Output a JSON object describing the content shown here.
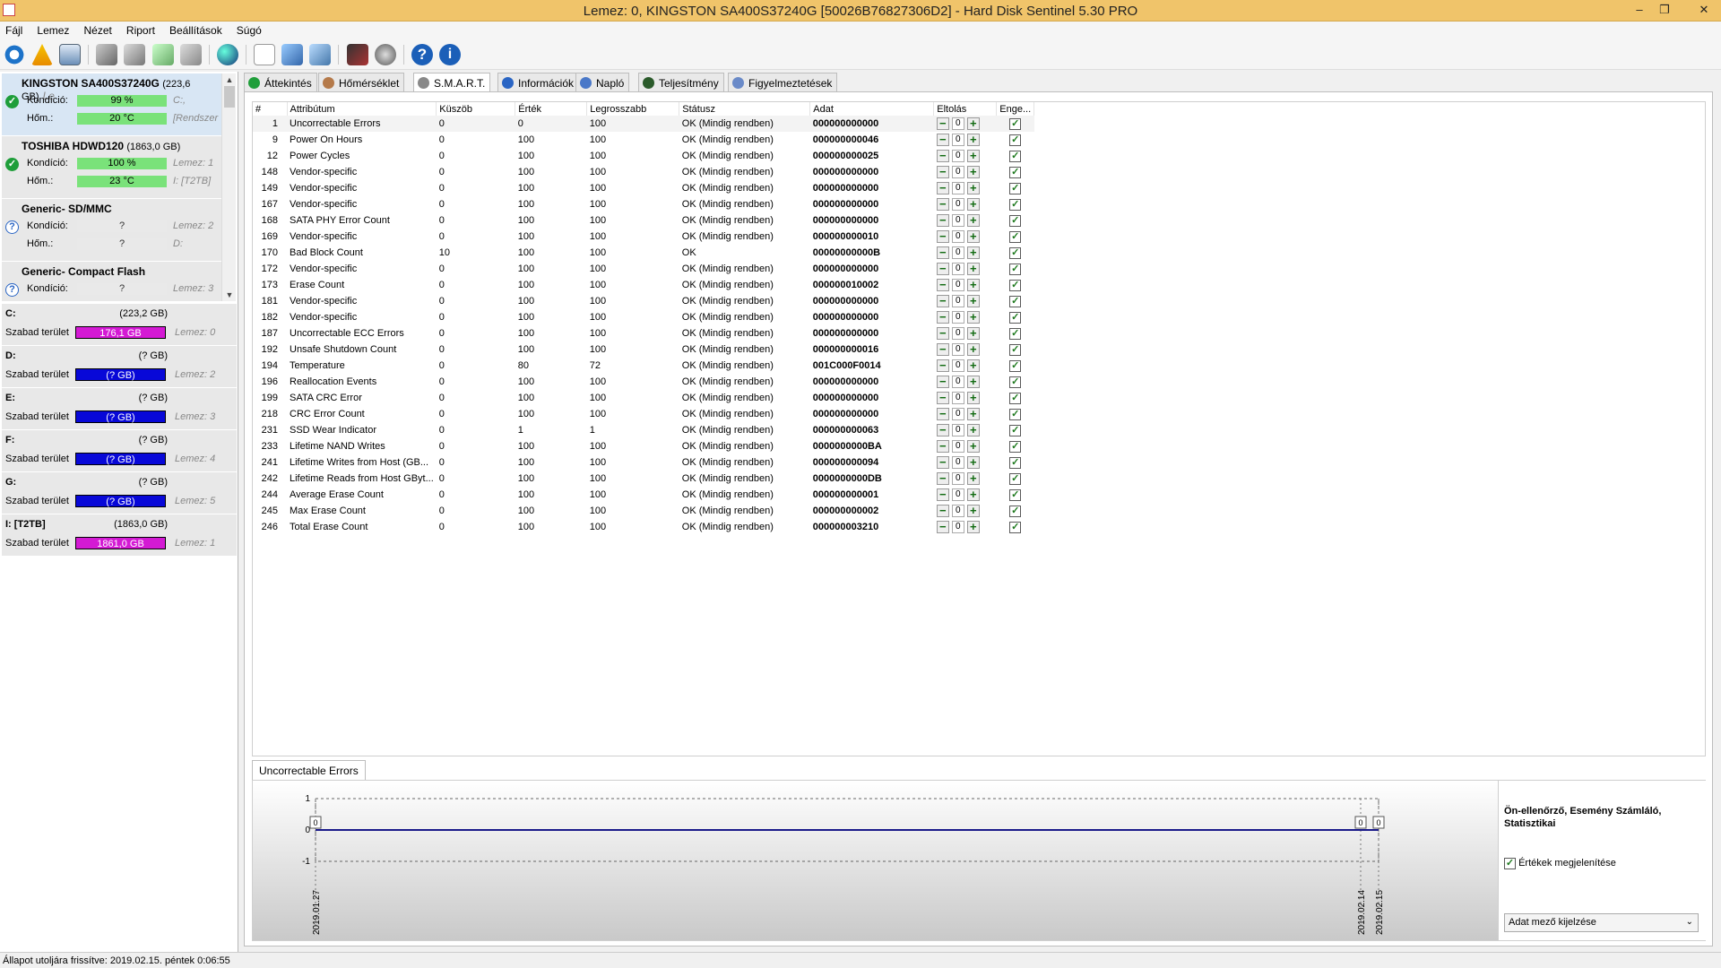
{
  "window": {
    "title": "Lemez: 0, KINGSTON SA400S37240G [50026B76827306D2]  -  Hard Disk Sentinel 5.30 PRO",
    "minimize": "–",
    "restore": "❐",
    "close": "✕"
  },
  "menu": [
    "Fájl",
    "Lemez",
    "Nézet",
    "Riport",
    "Beállítások",
    "Súgó"
  ],
  "disks": [
    {
      "name": "KINGSTON SA400S37240G",
      "size": "(223,6 GB)",
      "side_name": "Le",
      "status": "ok",
      "cond_label": "Kondíció:",
      "cond": "99 %",
      "cond_side": "C:,",
      "temp_label": "Hőm.:",
      "temp": "20 °C",
      "temp_side": "[Rendszer"
    },
    {
      "name": "TOSHIBA HDWD120",
      "size": "(1863,0 GB)",
      "side_name": "",
      "status": "ok",
      "cond_label": "Kondíció:",
      "cond": "100 %",
      "cond_side": "Lemez: 1",
      "temp_label": "Hőm.:",
      "temp": "23 °C",
      "temp_side": "I: [T2TB]"
    },
    {
      "name": "Generic- SD/MMC",
      "size": "",
      "side_name": "",
      "status": "q",
      "cond_label": "Kondíció:",
      "cond": "?",
      "cond_side": "Lemez: 2",
      "temp_label": "Hőm.:",
      "temp": "?",
      "temp_side": "D:"
    },
    {
      "name": "Generic- Compact Flash",
      "size": "",
      "side_name": "",
      "status": "q",
      "cond_label": "Kondíció:",
      "cond": "?",
      "cond_side": "Lemez: 3",
      "temp_label": "",
      "temp": "",
      "temp_side": ""
    }
  ],
  "volumes": [
    {
      "name": "C:",
      "size": "(223,2 GB)",
      "label": "Szabad terület",
      "free": "176,1 GB",
      "color": "mag",
      "disk": "Lemez: 0"
    },
    {
      "name": "D:",
      "size": "(? GB)",
      "label": "Szabad terület",
      "free": "(? GB)",
      "color": "blue",
      "disk": "Lemez: 2"
    },
    {
      "name": "E:",
      "size": "(? GB)",
      "label": "Szabad terület",
      "free": "(? GB)",
      "color": "blue",
      "disk": "Lemez: 3"
    },
    {
      "name": "F:",
      "size": "(? GB)",
      "label": "Szabad terület",
      "free": "(? GB)",
      "color": "blue",
      "disk": "Lemez: 4"
    },
    {
      "name": "G:",
      "size": "(? GB)",
      "label": "Szabad terület",
      "free": "(? GB)",
      "color": "blue",
      "disk": "Lemez: 5"
    },
    {
      "name": "I: [T2TB]",
      "size": "(1863,0 GB)",
      "label": "Szabad terület",
      "free": "1861,0 GB",
      "color": "mag",
      "disk": "Lemez: 1"
    }
  ],
  "tabs": [
    {
      "label": "Áttekintés",
      "icon": "check-icon",
      "color": "#1f9e3a"
    },
    {
      "label": "Hőmérséklet",
      "icon": "thermometer-icon",
      "color": "#b57a4a"
    },
    {
      "label": "S.M.A.R.T.",
      "icon": "disk-icon",
      "color": "#888"
    },
    {
      "label": "Információk",
      "icon": "info-icon",
      "color": "#2a65c4"
    },
    {
      "label": "Napló",
      "icon": "log-icon",
      "color": "#4a78c8"
    },
    {
      "label": "Teljesítmény",
      "icon": "speed-icon",
      "color": "#2a5a2a"
    },
    {
      "label": "Figyelmeztetések",
      "icon": "alert-icon",
      "color": "#6a8ac8"
    }
  ],
  "smart": {
    "headers": [
      "#",
      "Attribútum",
      "Küszöb",
      "Érték",
      "Legrosszabb",
      "Státusz",
      "Adat",
      "Eltolás",
      "Enge..."
    ],
    "rows": [
      [
        "1",
        "Uncorrectable Errors",
        "0",
        "0",
        "100",
        "OK (Mindig rendben)",
        "000000000000"
      ],
      [
        "9",
        "Power On Hours",
        "0",
        "100",
        "100",
        "OK (Mindig rendben)",
        "000000000046"
      ],
      [
        "12",
        "Power Cycles",
        "0",
        "100",
        "100",
        "OK (Mindig rendben)",
        "000000000025"
      ],
      [
        "148",
        "Vendor-specific",
        "0",
        "100",
        "100",
        "OK (Mindig rendben)",
        "000000000000"
      ],
      [
        "149",
        "Vendor-specific",
        "0",
        "100",
        "100",
        "OK (Mindig rendben)",
        "000000000000"
      ],
      [
        "167",
        "Vendor-specific",
        "0",
        "100",
        "100",
        "OK (Mindig rendben)",
        "000000000000"
      ],
      [
        "168",
        "SATA PHY Error Count",
        "0",
        "100",
        "100",
        "OK (Mindig rendben)",
        "000000000000"
      ],
      [
        "169",
        "Vendor-specific",
        "0",
        "100",
        "100",
        "OK (Mindig rendben)",
        "000000000010"
      ],
      [
        "170",
        "Bad Block Count",
        "10",
        "100",
        "100",
        "OK",
        "00000000000B"
      ],
      [
        "172",
        "Vendor-specific",
        "0",
        "100",
        "100",
        "OK (Mindig rendben)",
        "000000000000"
      ],
      [
        "173",
        "Erase Count",
        "0",
        "100",
        "100",
        "OK (Mindig rendben)",
        "000000010002"
      ],
      [
        "181",
        "Vendor-specific",
        "0",
        "100",
        "100",
        "OK (Mindig rendben)",
        "000000000000"
      ],
      [
        "182",
        "Vendor-specific",
        "0",
        "100",
        "100",
        "OK (Mindig rendben)",
        "000000000000"
      ],
      [
        "187",
        "Uncorrectable ECC Errors",
        "0",
        "100",
        "100",
        "OK (Mindig rendben)",
        "000000000000"
      ],
      [
        "192",
        "Unsafe Shutdown Count",
        "0",
        "100",
        "100",
        "OK (Mindig rendben)",
        "000000000016"
      ],
      [
        "194",
        "Temperature",
        "0",
        "80",
        "72",
        "OK (Mindig rendben)",
        "001C000F0014"
      ],
      [
        "196",
        "Reallocation Events",
        "0",
        "100",
        "100",
        "OK (Mindig rendben)",
        "000000000000"
      ],
      [
        "199",
        "SATA CRC Error",
        "0",
        "100",
        "100",
        "OK (Mindig rendben)",
        "000000000000"
      ],
      [
        "218",
        "CRC Error Count",
        "0",
        "100",
        "100",
        "OK (Mindig rendben)",
        "000000000000"
      ],
      [
        "231",
        "SSD Wear Indicator",
        "0",
        "1",
        "1",
        "OK (Mindig rendben)",
        "000000000063"
      ],
      [
        "233",
        "Lifetime NAND Writes",
        "0",
        "100",
        "100",
        "OK (Mindig rendben)",
        "0000000000BA"
      ],
      [
        "241",
        "Lifetime Writes from Host (GB...",
        "0",
        "100",
        "100",
        "OK (Mindig rendben)",
        "000000000094"
      ],
      [
        "242",
        "Lifetime Reads from Host GByt...",
        "0",
        "100",
        "100",
        "OK (Mindig rendben)",
        "0000000000DB"
      ],
      [
        "244",
        "Average Erase Count",
        "0",
        "100",
        "100",
        "OK (Mindig rendben)",
        "000000000001"
      ],
      [
        "245",
        "Max Erase Count",
        "0",
        "100",
        "100",
        "OK (Mindig rendben)",
        "000000000002"
      ],
      [
        "246",
        "Total Erase Count",
        "0",
        "100",
        "100",
        "OK (Mindig rendben)",
        "000000003210"
      ]
    ],
    "offset_value": "0",
    "minus": "−",
    "plus": "+",
    "check": "✓"
  },
  "bottom_tab": "Uncorrectable Errors",
  "chart_data": {
    "type": "line",
    "title": "",
    "x": [
      "2019.01.27",
      "2019.02.14",
      "2019.02.15"
    ],
    "series": [
      {
        "values": [
          0,
          0,
          0
        ]
      }
    ],
    "point_labels": [
      "0",
      "0",
      "0"
    ],
    "y_ticks": [
      "1",
      "0",
      "-1"
    ],
    "ylim": [
      -1,
      1
    ],
    "color": "#1a1a8a"
  },
  "right_panel": {
    "header": "Ön-ellenőrző, Esemény Számláló, Statisztikai",
    "checkbox_label": "Értékek megjelenítése",
    "checkbox_checked": true,
    "select_value": "Adat mező kijelzése"
  },
  "status": "Állapot utoljára frissítve: 2019.02.15. péntek 0:06:55"
}
